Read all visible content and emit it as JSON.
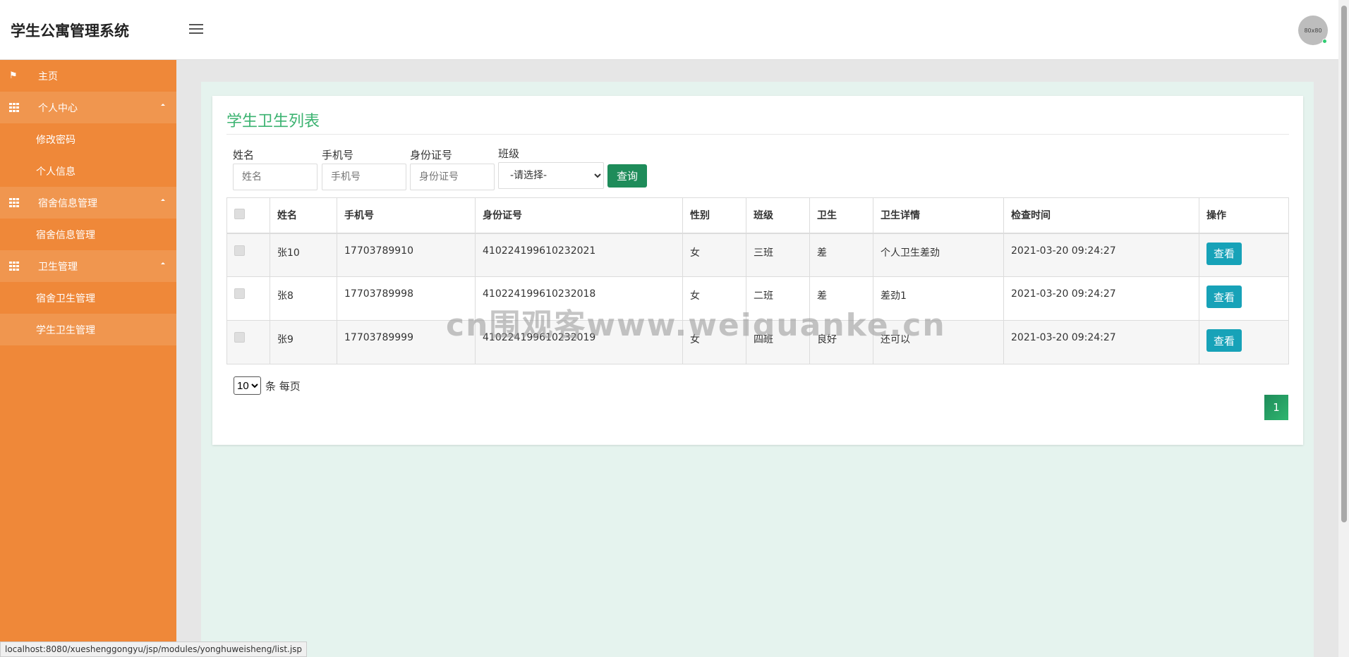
{
  "header": {
    "title": "学生公寓管理系统",
    "avatar_label": "80x80"
  },
  "sidebar": {
    "items": [
      {
        "label": "主页",
        "icon": "flag-icon",
        "type": "top"
      },
      {
        "label": "个人中心",
        "icon": "grid-icon",
        "type": "group"
      },
      {
        "label": "修改密码",
        "type": "sub"
      },
      {
        "label": "个人信息",
        "type": "sub"
      },
      {
        "label": "宿舍信息管理",
        "icon": "grid-icon",
        "type": "group"
      },
      {
        "label": "宿舍信息管理",
        "type": "sub"
      },
      {
        "label": "卫生管理",
        "icon": "grid-icon",
        "type": "group"
      },
      {
        "label": "宿舍卫生管理",
        "type": "sub"
      },
      {
        "label": "学生卫生管理",
        "type": "sub",
        "active": true
      }
    ]
  },
  "page": {
    "title": "学生卫生列表"
  },
  "filters": {
    "name_label": "姓名",
    "name_placeholder": "姓名",
    "phone_label": "手机号",
    "phone_placeholder": "手机号",
    "id_label": "身份证号",
    "id_placeholder": "身份证号",
    "class_label": "班级",
    "class_selected": "-请选择-",
    "query_button": "查询"
  },
  "table": {
    "headers": [
      "姓名",
      "手机号",
      "身份证号",
      "性别",
      "班级",
      "卫生",
      "卫生详情",
      "检查时间",
      "操作"
    ],
    "action_label": "查看",
    "rows": [
      {
        "name": "张10",
        "phone": "17703789910",
        "id": "410224199610232021",
        "gender": "女",
        "class": "三班",
        "hygiene": "差",
        "detail": "个人卫生差劲",
        "time": "2021-03-20 09:24:27"
      },
      {
        "name": "张8",
        "phone": "17703789998",
        "id": "410224199610232018",
        "gender": "女",
        "class": "二班",
        "hygiene": "差",
        "detail": "差劲1",
        "time": "2021-03-20 09:24:27"
      },
      {
        "name": "张9",
        "phone": "17703789999",
        "id": "410224199610232019",
        "gender": "女",
        "class": "四班",
        "hygiene": "良好",
        "detail": "还可以",
        "time": "2021-03-20 09:24:27"
      }
    ]
  },
  "pagination": {
    "page_size": "10",
    "page_size_suffix": "条 每页",
    "current_page": "1"
  },
  "watermark": "cn围观客www.weiguanke.cn",
  "status_url": "localhost:8080/xueshenggongyu/jsp/modules/yonghuweisheng/list.jsp"
}
